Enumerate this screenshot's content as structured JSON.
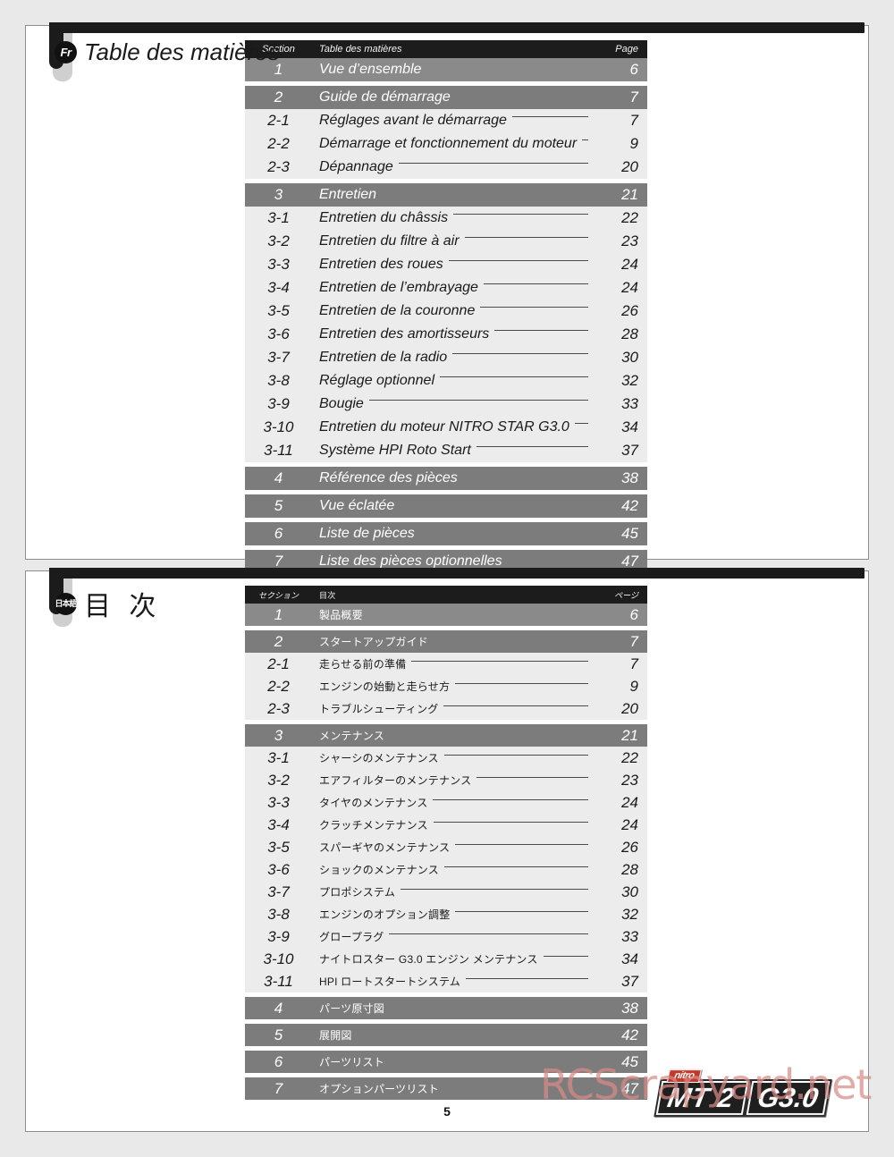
{
  "document": {
    "folio": "5",
    "watermark": "RCScrapyard.net"
  },
  "logo": {
    "nitro": "nitro",
    "model": "MT 2",
    "engine": "G3.0"
  },
  "pages": [
    {
      "lang_badge": "Fr",
      "title": "Table des matières",
      "header": {
        "section": "Section",
        "name": "Table des matières",
        "page": "Page"
      },
      "rows": [
        {
          "kind": "group",
          "section": "1",
          "name": "Vue d’ensemble",
          "page": "6"
        },
        {
          "kind": "group",
          "section": "2",
          "name": "Guide de démarrage",
          "page": "7"
        },
        {
          "kind": "sub",
          "section": "2-1",
          "name": "Réglages avant le démarrage",
          "page": "7"
        },
        {
          "kind": "sub",
          "section": "2-2",
          "name": "Démarrage et fonctionnement du moteur",
          "page": "9"
        },
        {
          "kind": "sub",
          "section": "2-3",
          "name": "Dépannage",
          "page": "20"
        },
        {
          "kind": "group",
          "section": "3",
          "name": "Entretien",
          "page": "21"
        },
        {
          "kind": "sub",
          "section": "3-1",
          "name": "Entretien du châssis",
          "page": "22"
        },
        {
          "kind": "sub",
          "section": "3-2",
          "name": "Entretien du filtre à air",
          "page": "23"
        },
        {
          "kind": "sub",
          "section": "3-3",
          "name": "Entretien des roues",
          "page": "24"
        },
        {
          "kind": "sub",
          "section": "3-4",
          "name": "Entretien de l’embrayage",
          "page": "24"
        },
        {
          "kind": "sub",
          "section": "3-5",
          "name": "Entretien de la couronne",
          "page": "26"
        },
        {
          "kind": "sub",
          "section": "3-6",
          "name": "Entretien des amortisseurs",
          "page": "28"
        },
        {
          "kind": "sub",
          "section": "3-7",
          "name": "Entretien de la radio",
          "page": "30"
        },
        {
          "kind": "sub",
          "section": "3-8",
          "name": "Réglage optionnel",
          "page": "32"
        },
        {
          "kind": "sub",
          "section": "3-9",
          "name": "Bougie",
          "page": "33"
        },
        {
          "kind": "sub",
          "section": "3-10",
          "name": "Entretien du moteur NITRO STAR G3.0",
          "page": "34"
        },
        {
          "kind": "sub",
          "section": "3-11",
          "name": "Système HPI Roto Start",
          "page": "37"
        },
        {
          "kind": "group",
          "section": "4",
          "name": "Référence des pièces",
          "page": "38"
        },
        {
          "kind": "group",
          "section": "5",
          "name": "Vue éclatée",
          "page": "42"
        },
        {
          "kind": "group",
          "section": "6",
          "name": "Liste de pièces",
          "page": "45"
        },
        {
          "kind": "group",
          "section": "7",
          "name": "Liste des pièces optionnelles",
          "page": "47"
        }
      ]
    },
    {
      "lang_badge": "日本語",
      "title": "目 次",
      "header": {
        "section": "セクション",
        "name": "目次",
        "page": "ページ"
      },
      "rows": [
        {
          "kind": "group",
          "section": "1",
          "name": "製品概要",
          "page": "6"
        },
        {
          "kind": "group",
          "section": "2",
          "name": "スタートアップガイド",
          "page": "7"
        },
        {
          "kind": "sub",
          "section": "2-1",
          "name": "走らせる前の準備",
          "page": "7"
        },
        {
          "kind": "sub",
          "section": "2-2",
          "name": "エンジンの始動と走らせ方",
          "page": "9"
        },
        {
          "kind": "sub",
          "section": "2-3",
          "name": "トラブルシューティング",
          "page": "20"
        },
        {
          "kind": "group",
          "section": "3",
          "name": "メンテナンス",
          "page": "21"
        },
        {
          "kind": "sub",
          "section": "3-1",
          "name": "シャーシのメンテナンス",
          "page": "22"
        },
        {
          "kind": "sub",
          "section": "3-2",
          "name": "エアフィルターのメンテナンス",
          "page": "23"
        },
        {
          "kind": "sub",
          "section": "3-3",
          "name": "タイヤのメンテナンス",
          "page": "24"
        },
        {
          "kind": "sub",
          "section": "3-4",
          "name": "クラッチメンテナンス",
          "page": "24"
        },
        {
          "kind": "sub",
          "section": "3-5",
          "name": "スパーギヤのメンテナンス",
          "page": "26"
        },
        {
          "kind": "sub",
          "section": "3-6",
          "name": "ショックのメンテナンス",
          "page": "28"
        },
        {
          "kind": "sub",
          "section": "3-7",
          "name": "プロポシステム",
          "page": "30"
        },
        {
          "kind": "sub",
          "section": "3-8",
          "name": "エンジンのオプション調整",
          "page": "32"
        },
        {
          "kind": "sub",
          "section": "3-9",
          "name": "グロープラグ",
          "page": "33"
        },
        {
          "kind": "sub",
          "section": "3-10",
          "name": "ナイトロスター G3.0 エンジン メンテナンス",
          "page": "34"
        },
        {
          "kind": "sub",
          "section": "3-11",
          "name": "HPI ロートスタートシステム",
          "page": "37"
        },
        {
          "kind": "group",
          "section": "4",
          "name": "パーツ原寸図",
          "page": "38"
        },
        {
          "kind": "group",
          "section": "5",
          "name": "展開図",
          "page": "42"
        },
        {
          "kind": "group",
          "section": "6",
          "name": "パーツリスト",
          "page": "45"
        },
        {
          "kind": "group",
          "section": "7",
          "name": "オプションパーツリスト",
          "page": "47"
        }
      ]
    }
  ]
}
